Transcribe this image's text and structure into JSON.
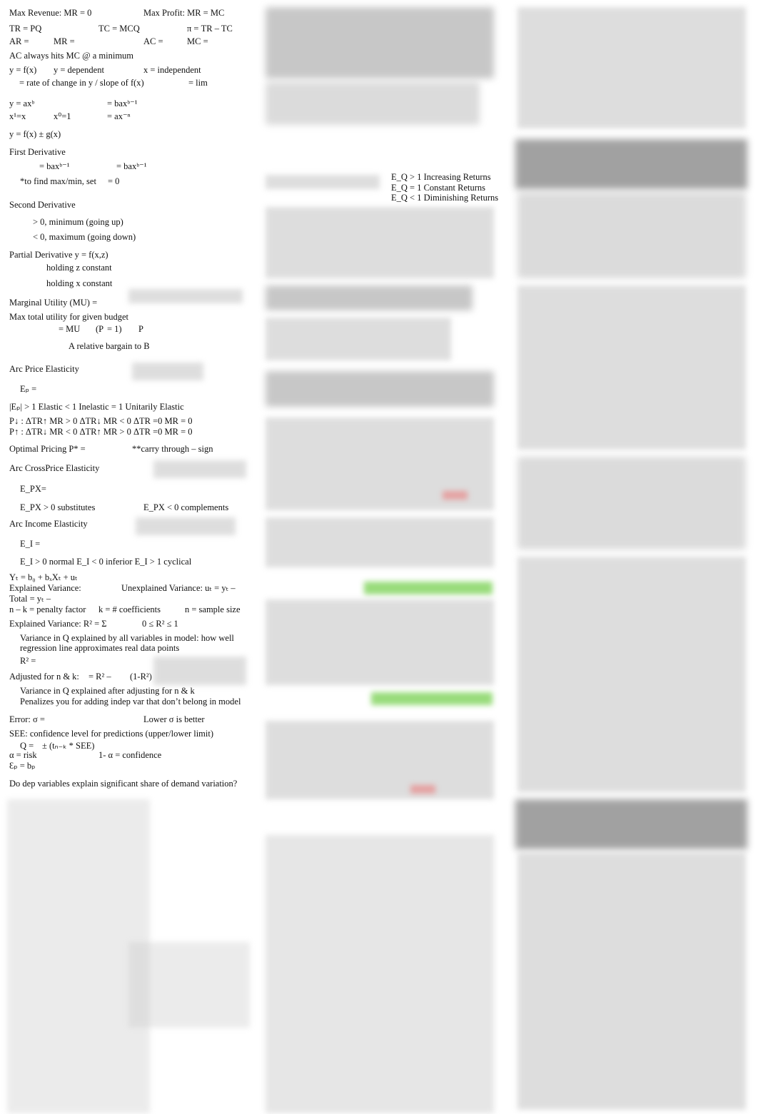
{
  "left": {
    "max_revenue": "Max Revenue: MR = 0",
    "max_profit": "Max Profit: MR = MC",
    "tr": "TR = PQ",
    "tc": "TC = MCQ",
    "pi": "π = TR – TC",
    "ar": "AR =",
    "mr": "MR =",
    "ac": "AC =",
    "mc": "MC =",
    "ac_mc": "AC always hits MC @ a minimum",
    "yfx": "y = f(x)",
    "ydep": "y = dependent",
    "xindep": "x = independent",
    "rate": "= rate of change in y / slope of f(x)",
    "lim": "= lim",
    "power": "y = axᵇ",
    "power_d": "= baxᵇ⁻¹",
    "x1": "x¹=x",
    "x0": "x⁰=1",
    "neg": "= ax⁻ⁿ",
    "sum": "y = f(x) ± g(x)",
    "first_deriv": "First Derivative",
    "fd_a": "= baxᵇ⁻¹",
    "fd_b": "= baxᵇ⁻¹",
    "fd_set": "*to find max/min, set",
    "fd_zero": "= 0",
    "second_deriv": "Second Derivative",
    "min": "> 0, minimum (going up)",
    "max": "< 0, maximum (going down)",
    "partial": "Partial Derivative y = f(x,z)",
    "hold_z": "holding z constant",
    "hold_x": "holding x constant",
    "mu": "Marginal Utility (MU) =",
    "max_util": "Max total utility for given budget",
    "mu_eq": "= MU",
    "mu_sub": "M",
    "pm": "(P",
    "pm2": "= 1)",
    "pa": "P",
    "pa2": "=",
    "bargain": "A relative bargain to B",
    "arc_price": "Arc Price Elasticity",
    "ep": "Eₚ =",
    "elastic": "|Eₚ| > 1 Elastic     < 1 Inelastic     = 1 Unitarily Elastic",
    "pdown": "P↓  : ΔTR↑   MR > 0    ΔTR↓   MR < 0    ΔTR =0 MR = 0",
    "pup": "P↑  : ΔTR↓   MR < 0    ΔTR↑   MR > 0    ΔTR =0 MR = 0",
    "optimal": "Optimal Pricing P* =",
    "carry": "**carry through – sign",
    "cross": "Arc CrossPrice Elasticity",
    "epx": "E_PX=",
    "subs": "E_PX > 0 substitutes",
    "comps": "E_PX < 0 complements",
    "income": "Arc Income Elasticity",
    "ei": "E_I =",
    "normal": "E_I > 0 normal     E_I < 0 inferior     E_I > 1 cyclical",
    "regression": "Yₜ = b₀  + bₓXₜ + uₜ",
    "explained": "Explained Variance:",
    "unexplained": "Unexplained Variance: uₜ = yₜ –",
    "total": "Total = yₜ –",
    "penalty": "n – k = penalty factor",
    "coeffs": "k = # coefficients",
    "sample": "n = sample size",
    "r2": "Explained Variance: R² = Σ",
    "r2range": "0 ≤ R² ≤ 1",
    "r2_desc1": "Variance in Q explained by all variables in model: how well",
    "r2_desc2": "regression line approximates real data points",
    "r2_eq": "R² =",
    "adj": "Adjusted for n & k:",
    "adj_eq": "= R² –",
    "adj_tail": "(1-R²)",
    "adj_desc1": "Variance in Q explained after adjusting for n & k",
    "adj_desc2": "Penalizes you for adding indep var that don’t belong in model",
    "error": "Error: σ =",
    "lower": "Lower σ is better",
    "see": "SEE: confidence level for predictions (upper/lower limit)",
    "q": "Q =",
    "q2": "± (tₙ₋ₖ * SEE)",
    "alpha": "α = risk",
    "conf": "1- α = confidence",
    "ep_bp": "Ɛₚ = bₚ",
    "question": "Do dep variables explain significant share of demand variation?"
  },
  "middle": {
    "eq_inc": "E_Q > 1 Increasing Returns",
    "eq_const": "E_Q = 1 Constant Returns",
    "eq_dim": "E_Q < 1 Diminishing Returns"
  }
}
